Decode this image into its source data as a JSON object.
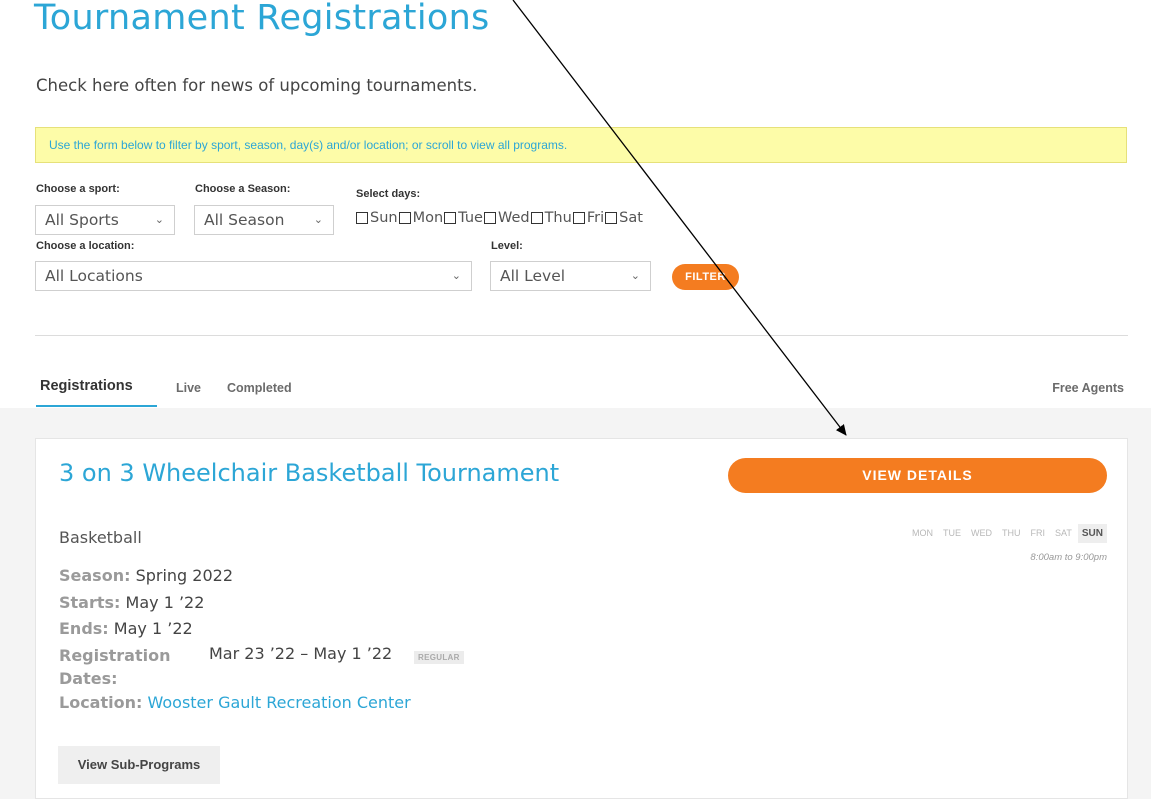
{
  "page": {
    "title": "Tournament Registrations",
    "intro": "Check here often for news of upcoming tournaments.",
    "notice": "Use the form below to filter by sport, season, day(s) and/or location; or scroll to view all programs."
  },
  "filters": {
    "sport_label": "Choose a sport:",
    "sport_value": "All Sports",
    "season_label": "Choose a Season:",
    "season_value": "All Season",
    "days_label": "Select days:",
    "days": [
      "Sun",
      "Mon",
      "Tue",
      "Wed",
      "Thu",
      "Fri",
      "Sat"
    ],
    "location_label": "Choose a location:",
    "location_value": "All Locations",
    "level_label": "Level:",
    "level_value": "All Level",
    "filter_button": "FILTER"
  },
  "tabs": {
    "registrations": "Registrations",
    "live": "Live",
    "completed": "Completed",
    "free_agents": "Free Agents"
  },
  "program": {
    "title": "3 on 3 Wheelchair Basketball Tournament",
    "sport": "Basketball",
    "season_label": "Season:",
    "season": "Spring 2022",
    "starts_label": "Starts:",
    "starts": "May 1 ’22",
    "ends_label": "Ends:",
    "ends": "May 1 ’22",
    "registration_label": "Registration Dates:",
    "registration_dates": "Mar 23 ’22 – May 1 ’22",
    "registration_tag": "REGULAR",
    "location_label": "Location:",
    "location": "Wooster Gault Recreation Center",
    "view_details": "VIEW DETAILS",
    "weekdays": [
      "MON",
      "TUE",
      "WED",
      "THU",
      "FRI",
      "SAT",
      "SUN"
    ],
    "active_day": "SUN",
    "time": "8:00am to 9:00pm",
    "sub_programs_button": "View Sub-Programs"
  },
  "colors": {
    "accent_blue": "#2ca6d6",
    "accent_orange": "#f47c20",
    "notice_bg": "#fdfca8"
  }
}
